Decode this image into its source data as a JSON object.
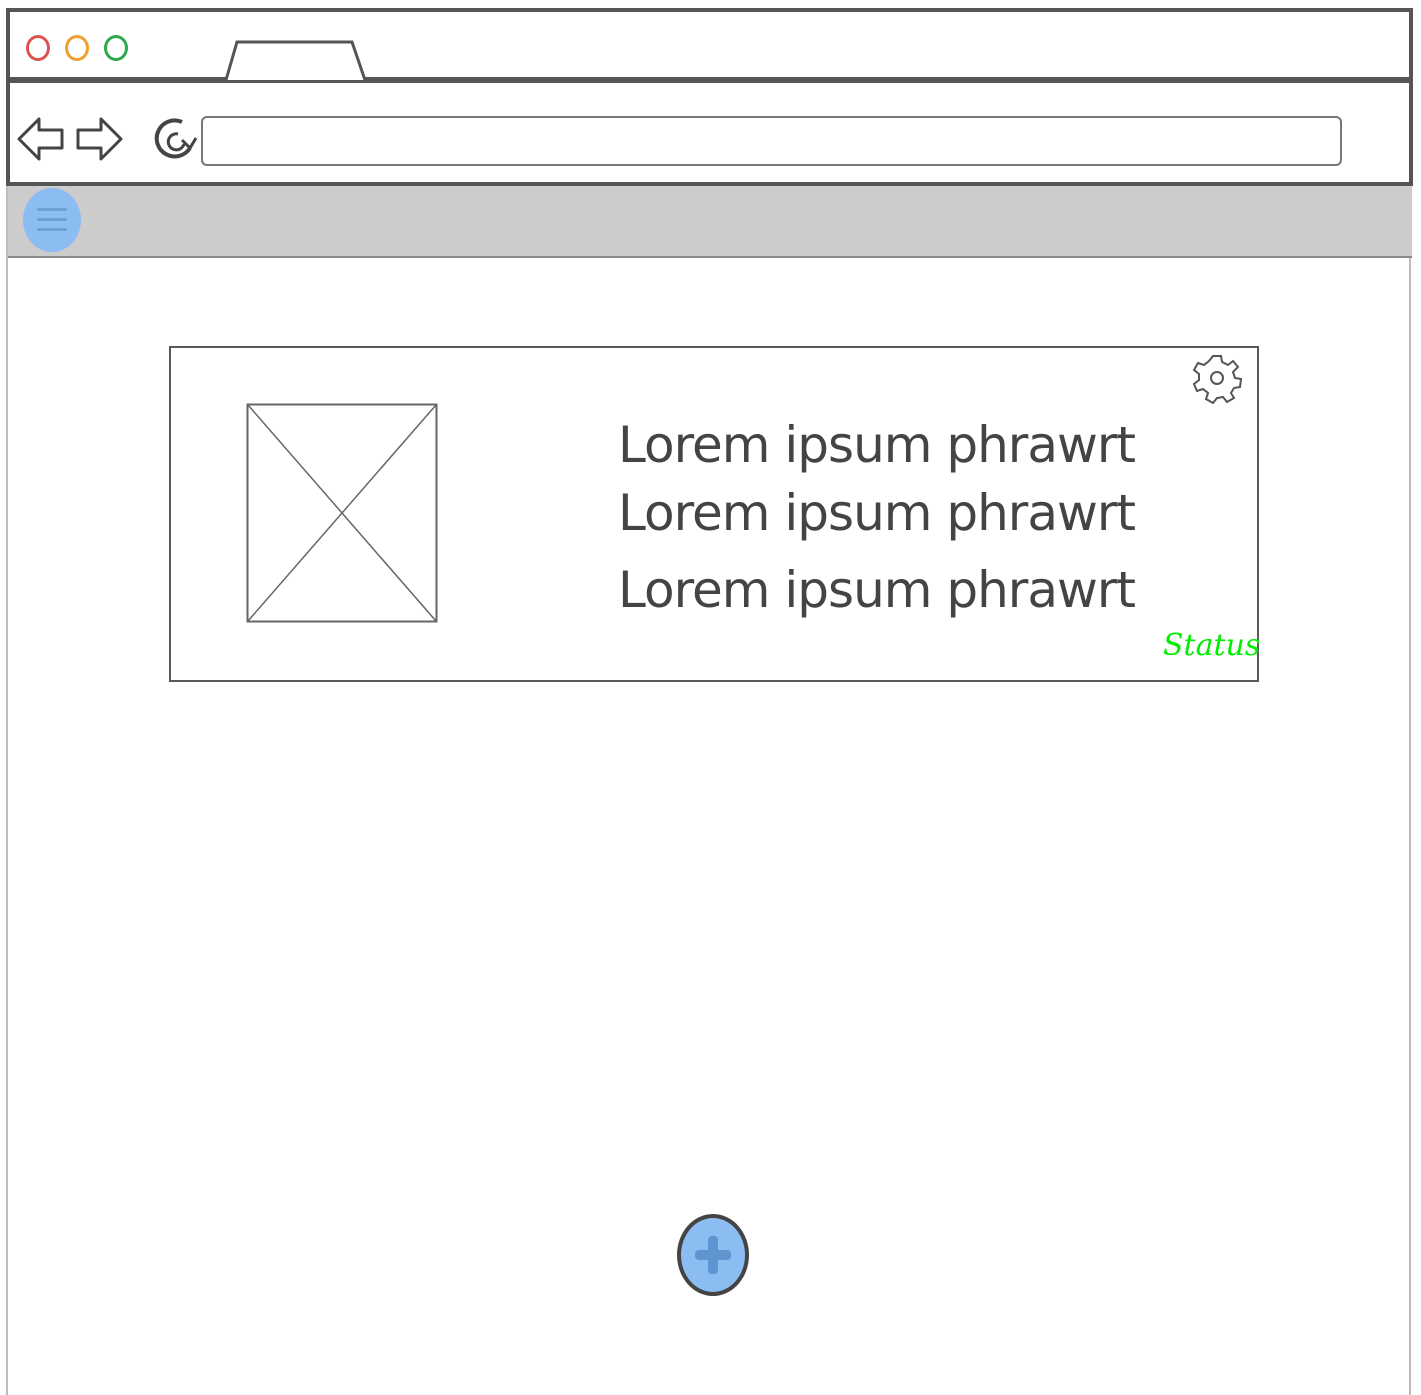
{
  "browser": {
    "traffic_lights": {
      "close_color": "#d9534f",
      "minimize_color": "#f0a030",
      "maximize_color": "#2ea84a"
    },
    "tab_label": "",
    "address_value": "",
    "icons": [
      "back-arrow-icon",
      "forward-arrow-icon",
      "refresh-icon"
    ]
  },
  "toolbar": {
    "menu_icon": "hamburger-icon",
    "accent_color": "#8bbcf2"
  },
  "card": {
    "image_placeholder": "image-placeholder-icon",
    "lines": [
      "Lorem ipsum phrawrt",
      "Lorem ipsum phrawrt",
      "Lorem ipsum phrawrt"
    ],
    "status": "Status",
    "status_color": "#00ee00",
    "settings_icon": "gear-icon"
  },
  "fab": {
    "icon": "plus-icon",
    "color": "#8bbcf2"
  }
}
